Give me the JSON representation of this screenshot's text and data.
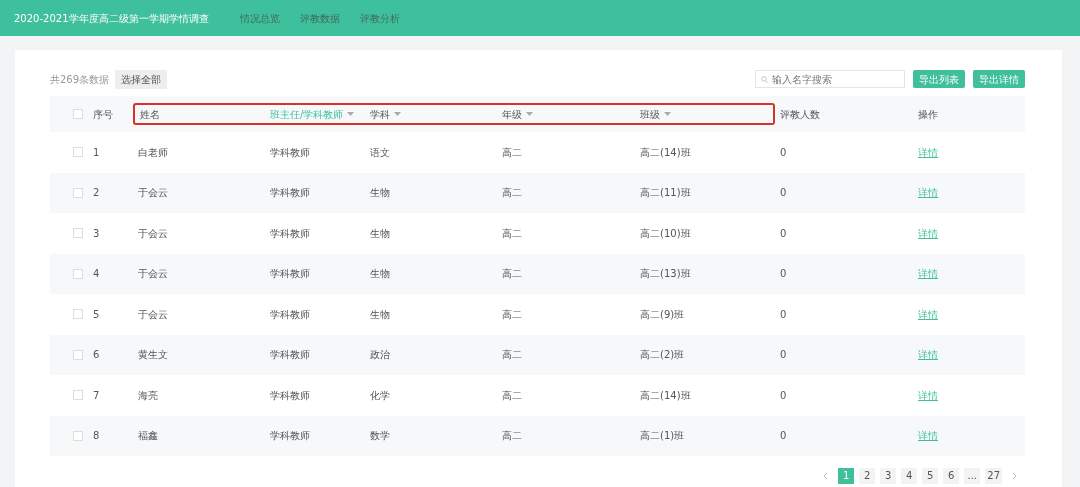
{
  "header": {
    "title": "2020-2021学年度高二级第一学期学情调查",
    "tabs": [
      {
        "label": "情况总览",
        "selected": false
      },
      {
        "label": "评教数据",
        "selected": false
      },
      {
        "label": "评教分析",
        "selected": false
      }
    ]
  },
  "toolbar": {
    "count": "共269条数据",
    "select_all": "选择全部",
    "search": {
      "placeholder": "输入名字搜索"
    },
    "buttons": [
      "导出列表",
      "导出详情"
    ]
  },
  "table": {
    "select_all_checked": false,
    "columns": [
      {
        "label": "序号",
        "filter": false,
        "active": false,
        "highlighted": false
      },
      {
        "label": "姓名",
        "filter": false,
        "active": false,
        "highlighted": true
      },
      {
        "label": "班主任/学科教师",
        "filter": true,
        "active": true,
        "highlighted": true
      },
      {
        "label": "学科",
        "filter": true,
        "active": false,
        "highlighted": true
      },
      {
        "label": "年级",
        "filter": true,
        "active": false,
        "highlighted": true
      },
      {
        "label": "班级",
        "filter": true,
        "active": false,
        "highlighted": true
      },
      {
        "label": "评教人数",
        "filter": false,
        "active": false,
        "highlighted": false
      },
      {
        "label": "操作",
        "filter": false,
        "active": false,
        "highlighted": false
      }
    ],
    "rows": [
      {
        "checked": false,
        "cells": [
          "1",
          "白老师",
          "学科教师",
          "语文",
          "高二",
          "高二(14)班",
          "0"
        ],
        "action": "详情"
      },
      {
        "checked": false,
        "cells": [
          "2",
          "于会云",
          "学科教师",
          "生物",
          "高二",
          "高二(11)班",
          "0"
        ],
        "action": "详情"
      },
      {
        "checked": false,
        "cells": [
          "3",
          "于会云",
          "学科教师",
          "生物",
          "高二",
          "高二(10)班",
          "0"
        ],
        "action": "详情"
      },
      {
        "checked": false,
        "cells": [
          "4",
          "于会云",
          "学科教师",
          "生物",
          "高二",
          "高二(13)班",
          "0"
        ],
        "action": "详情"
      },
      {
        "checked": false,
        "cells": [
          "5",
          "于会云",
          "学科教师",
          "生物",
          "高二",
          "高二(9)班",
          "0"
        ],
        "action": "详情"
      },
      {
        "checked": false,
        "cells": [
          "6",
          "黄生文",
          "学科教师",
          "政治",
          "高二",
          "高二(2)班",
          "0"
        ],
        "action": "详情"
      },
      {
        "checked": false,
        "cells": [
          "7",
          "海亮",
          "学科教师",
          "化学",
          "高二",
          "高二(14)班",
          "0"
        ],
        "action": "详情"
      },
      {
        "checked": false,
        "cells": [
          "8",
          "福鑫",
          "学科教师",
          "数学",
          "高二",
          "高二(1)班",
          "0"
        ],
        "action": "详情"
      }
    ]
  },
  "pagination": {
    "pages": [
      {
        "label": "1",
        "selected": true
      },
      {
        "label": "2",
        "selected": false
      },
      {
        "label": "3",
        "selected": false
      },
      {
        "label": "4",
        "selected": false
      },
      {
        "label": "5",
        "selected": false
      },
      {
        "label": "6",
        "selected": false
      },
      {
        "label": "...",
        "selected": false
      },
      {
        "label": "27",
        "selected": false
      }
    ]
  }
}
